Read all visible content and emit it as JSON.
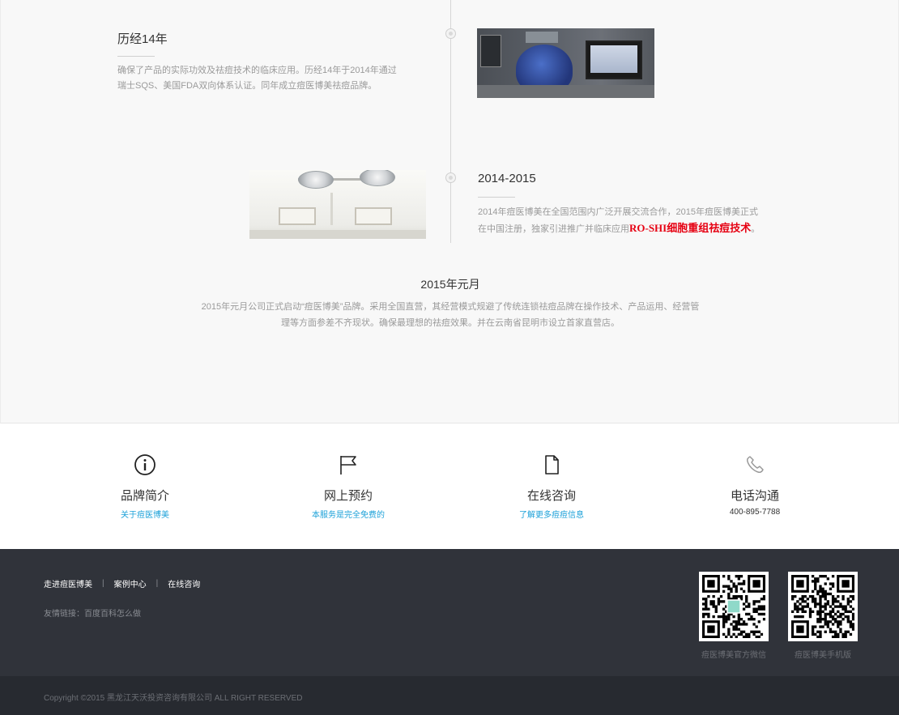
{
  "timeline": {
    "item1": {
      "title": "历经14年",
      "text_line1": "确保了产品的实际功效及祛痘技术的临床应用。历经14年于2014年通过",
      "text_line2": "瑞士SQS、美国FDA双向体系认证。同年成立痘医博美祛痘品牌。"
    },
    "item2": {
      "title": "2014-2015",
      "text_line1": "2014年痘医博美在全国范围内广泛开展交流合作，2015年痘医博美正式",
      "text_line2_prefix": "在中国注册，独家引进推广并临床应用",
      "text_highlight": "RO-SHI细胞重组祛痘技术",
      "text_line2_suffix": "。"
    },
    "item3": {
      "title": "2015年元月",
      "text_line1": "2015年元月公司正式启动“痘医博美”品牌。采用全国直营，其经营模式规避了传统连锁祛痘品牌在操作技术、产品运用、经营管",
      "text_line2": "理等方面参差不齐现状。确保最理想的祛痘效果。并在云南省昆明市设立首家直营店。"
    }
  },
  "features": [
    {
      "title": "品牌简介",
      "subtitle": "关于痘医博美",
      "icon": "info-circle-icon"
    },
    {
      "title": "网上预约",
      "subtitle": "本服务是完全免费的",
      "icon": "flag-icon"
    },
    {
      "title": "在线咨询",
      "subtitle": "了解更多痘痘信息",
      "icon": "document-icon"
    },
    {
      "title": "电话沟通",
      "subtitle": "400-895-7788",
      "icon": "phone-icon"
    }
  ],
  "footer": {
    "nav": [
      "走进痘医博美",
      "案例中心",
      "在线咨询"
    ],
    "separator": "|",
    "friend_links": "友情链接：百度百科怎么做",
    "qr_codes": [
      {
        "caption": "痘医博美官方微信"
      },
      {
        "caption": "痘医博美手机版"
      }
    ],
    "copyright": "Copyright ©2015 黑龙江天沃投资咨询有限公司 ALL RIGHT RESERVED"
  },
  "colors": {
    "accent_link": "#1aa0d8",
    "highlight_red": "#e60012",
    "footer_bg": "#30333a",
    "bottom_bg": "#272a30"
  }
}
